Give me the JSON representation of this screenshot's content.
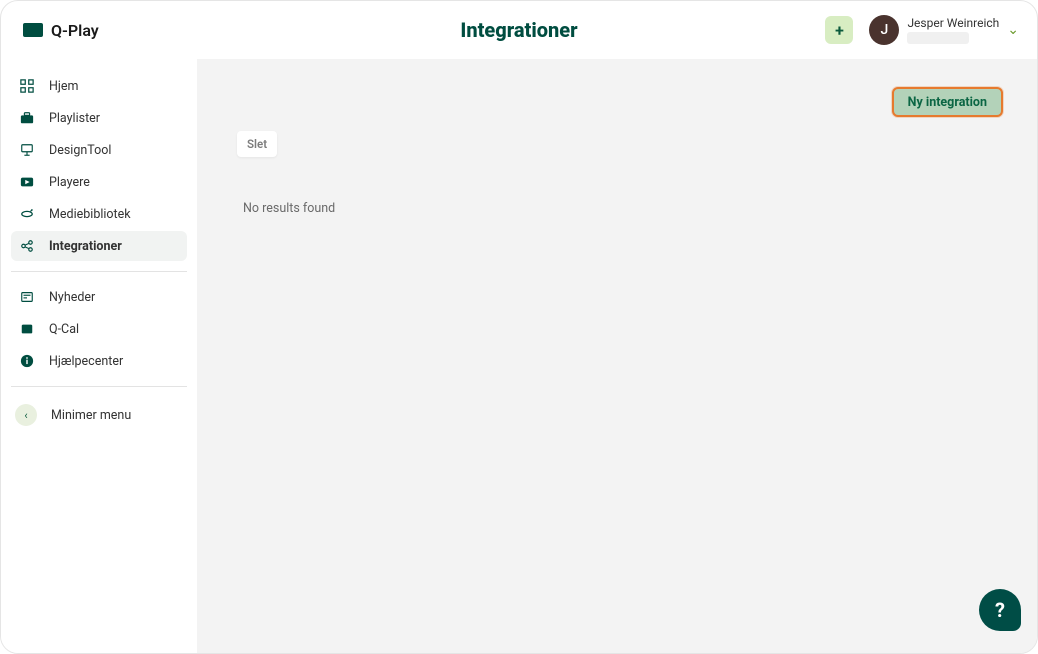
{
  "app": {
    "logo_text": "Q-Play",
    "page_title": "Integrationer"
  },
  "header": {
    "plus_label": "+",
    "user": {
      "initial": "J",
      "name": "Jesper Weinreich"
    },
    "chevron": "⌄"
  },
  "sidebar": {
    "items": [
      {
        "label": "Hjem",
        "icon": "grid"
      },
      {
        "label": "Playlister",
        "icon": "briefcase"
      },
      {
        "label": "DesignTool",
        "icon": "easel"
      },
      {
        "label": "Playere",
        "icon": "play"
      },
      {
        "label": "Mediebibliotek",
        "icon": "loop"
      },
      {
        "label": "Integrationer",
        "icon": "share",
        "active": true
      }
    ],
    "secondary": [
      {
        "label": "Nyheder",
        "icon": "news"
      },
      {
        "label": "Q-Cal",
        "icon": "cal"
      },
      {
        "label": "Hjælpecenter",
        "icon": "info"
      }
    ],
    "minimize_label": "Minimer menu",
    "minimize_glyph": "‹"
  },
  "main": {
    "new_integration_label": "Ny integration",
    "delete_label": "Slet",
    "no_results": "No results found"
  },
  "fab": {
    "label": "?"
  }
}
